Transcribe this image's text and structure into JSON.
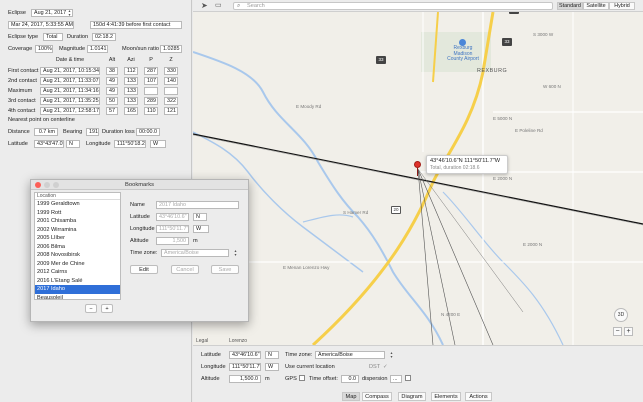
{
  "eclipse": {
    "label": "Eclipse",
    "value": "Aug 21, 2017",
    "datetime": "Mar 24, 2017, 5:33:55 AM",
    "relative": "150d 4:41:39 before first contact",
    "type_label": "Eclipse type",
    "type_value": "Total",
    "duration_label": "Duration",
    "duration_value": "02:18.2",
    "coverage_label": "Coverage",
    "coverage_value": "100%",
    "magnitude_label": "Magnitude",
    "magnitude_value": "1.0141",
    "ratio_label": "Moon/sun ratio",
    "ratio_value": "1.0285"
  },
  "contacts": {
    "headers": [
      "Date & time",
      "Alt",
      "Azi",
      "P",
      "Z"
    ],
    "rows": [
      {
        "label": "First contact",
        "datetime": "Aug 21, 2017, 10:15:34",
        "alt": "38",
        "azi": "112",
        "p": "287",
        "z": "330"
      },
      {
        "label": "2nd contact",
        "datetime": "Aug 21, 2017, 11:33:07",
        "alt": "49",
        "azi": "133",
        "p": "107",
        "z": "140"
      },
      {
        "label": "Maximum",
        "datetime": "Aug 21, 2017, 11:34:16",
        "alt": "49",
        "azi": "133",
        "p": "",
        "z": ""
      },
      {
        "label": "3rd contact",
        "datetime": "Aug 21, 2017, 11:35:25",
        "alt": "50",
        "azi": "133",
        "p": "289",
        "z": "322"
      },
      {
        "label": "4th contact",
        "datetime": "Aug 21, 2017, 12:58:17",
        "alt": "57",
        "azi": "165",
        "p": "110",
        "z": "121"
      }
    ]
  },
  "nearest": {
    "title": "Nearest point on centerline",
    "distance_label": "Distance",
    "distance_value": "0.7 km",
    "bearing_label": "Bearing",
    "bearing_value": "191",
    "dloss_label": "Duration loss",
    "dloss_value": "00:00.0",
    "lat_label": "Latitude",
    "lat_value": "43°43'47.0\"",
    "lat_dir": "N",
    "lon_label": "Longitude",
    "lon_value": "111°50'18.2\"",
    "lon_dir": "W"
  },
  "toolbar": {
    "search_placeholder": "Search",
    "segments": [
      "Standard",
      "Satellite",
      "Hybrid"
    ]
  },
  "map": {
    "callout_title": "43°46'10.6\"N 111°50'11.7\"W",
    "callout_sub": "Total, duration 02:18.6",
    "places": [
      {
        "name": "Rexburg Madison County Airport"
      },
      {
        "name": "REXBURG"
      },
      {
        "name": "E Moody Rd"
      },
      {
        "name": "S 3000 W"
      },
      {
        "name": "W 600 N"
      },
      {
        "name": "E 5000 N"
      },
      {
        "name": "E Poleline Rd"
      },
      {
        "name": "E 2000 N"
      },
      {
        "name": "S Hamer Rd"
      },
      {
        "name": "E 2000 N"
      },
      {
        "name": "E Menan Lorenzo Hwy"
      },
      {
        "name": "Lorenzo"
      },
      {
        "name": "N 4200 E"
      }
    ],
    "shields": [
      "33",
      "33",
      "20",
      "33"
    ],
    "legal": "Legal",
    "compass": "3D"
  },
  "location": {
    "lat_label": "Latitude",
    "lat_value": "43°46'10.6\"",
    "lat_dir": "N",
    "lon_label": "Longitude",
    "lon_value": "111°50'11.7\"",
    "lon_dir": "W",
    "alt_label": "Altitude",
    "alt_value": "1,500.0",
    "alt_unit": "m",
    "tz_label": "Time zone:",
    "tz_value": "America/Boise",
    "use_current": "Use current location",
    "dst": "DST",
    "gps_label": "GPS",
    "offset_label": "Time offset:",
    "offset_value": "0.0",
    "dispersion_label": "dispersion",
    "dispersion_value": "..."
  },
  "tabs": [
    "Map",
    "Compass",
    "Diagram",
    "Elements",
    "Actions"
  ],
  "bookmarks": {
    "title": "Bookmarks",
    "list_header": "Location",
    "items": [
      "1999 Geraldtown",
      "1999 Rott",
      "2001 Chisamba",
      "2002 Wirramina",
      "2005 Llíber",
      "2006 Bilma",
      "2008 Novosibirsk",
      "2009 Mer de Chine",
      "2012 Cairns",
      "2016 L'Etang Salé",
      "2017 Idaho",
      "Beausoleil"
    ],
    "selected_index": 10,
    "name_label": "Name",
    "name_value": "2017 Idaho",
    "lat_label": "Latitude",
    "lat_value": "43°46'10.6\"",
    "lat_dir": "N",
    "lon_label": "Longitude",
    "lon_value": "111°50'11.7\"",
    "lon_dir": "W",
    "alt_label": "Altitude",
    "alt_value": "1,500",
    "alt_unit": "m",
    "tz_label": "Time zone:",
    "tz_value": "America/Boise",
    "edit": "Edit",
    "cancel": "Cancel",
    "save": "Save",
    "remove": "−",
    "add": "+"
  },
  "colors": {
    "accent": "#2f6fd8",
    "road_major": "#f6cf4a",
    "river": "#a9c8ec",
    "pin": "#e0322a"
  }
}
